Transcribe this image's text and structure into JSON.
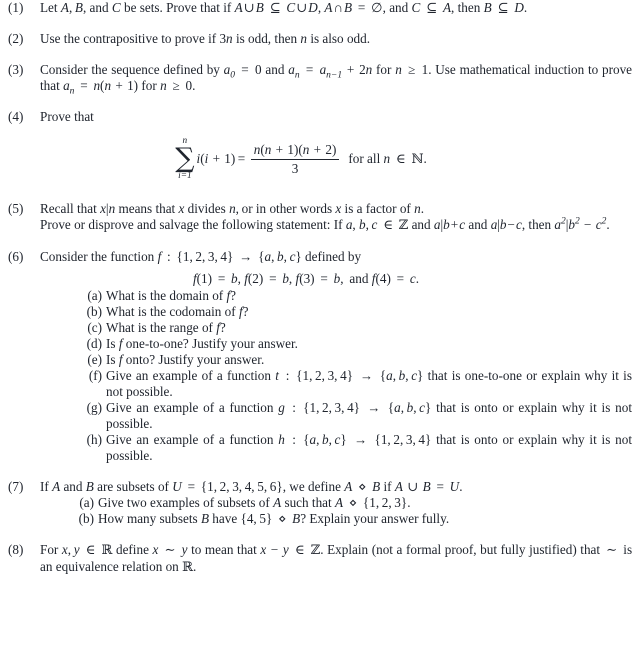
{
  "document": {
    "type": "mathematics-problem-set",
    "text_color": "#20252e",
    "background_color": "#ffffff"
  },
  "problems": [
    {
      "number": "(1)",
      "text": "Let A, B, and C be sets. Prove that if A∪B ⊆ C∪D, A∩B = ∅, and C ⊆ A, then B ⊆ D."
    },
    {
      "number": "(2)",
      "text": "Use the contrapositive to prove if 3n is odd, then n is also odd."
    },
    {
      "number": "(3)",
      "text": "Consider the sequence defined by a₀ = 0 and aₙ = aₙ₋₁ + 2n for n ≥ 1. Use mathematical induction to prove that aₙ = n(n + 1) for n ≥ 0."
    },
    {
      "number": "(4)",
      "text": "Prove that",
      "equation": {
        "sum_upper": "n",
        "sum_lower": "i=1",
        "summand": "i(i + 1)",
        "equals": "=",
        "numerator": "n(n + 1)(n + 2)",
        "denominator": "3",
        "tail": "for all n ∈ ℕ."
      }
    },
    {
      "number": "(5)",
      "line1": "Recall that x|n means that x divides n, or in other words x is a factor of n.",
      "line2": "Prove or disprove and salvage the following statement: If a, b, c ∈ ℤ and a|b+c and a|b−c, then a²|b² − c²."
    },
    {
      "number": "(6)",
      "text": "Consider the function f : {1, 2, 3, 4} → {a, b, c} defined by",
      "definition": "f(1) = b, f(2) = b, f(3) = b, and f(4) = c.",
      "subitems": [
        {
          "label": "(a)",
          "text": "What is the domain of f?"
        },
        {
          "label": "(b)",
          "text": "What is the codomain of f?"
        },
        {
          "label": "(c)",
          "text": "What is the range of f?"
        },
        {
          "label": "(d)",
          "text": "Is f one-to-one? Justify your answer."
        },
        {
          "label": "(e)",
          "text": "Is f onto? Justify your answer."
        },
        {
          "label": "(f)",
          "text": "Give an example of a function t : {1, 2, 3, 4} → {a, b, c} that is one-to-one or explain why it is not possible."
        },
        {
          "label": "(g)",
          "text": "Give an example of a function g : {1, 2, 3, 4} → {a, b, c} that is onto or explain why it is not possible."
        },
        {
          "label": "(h)",
          "text": "Give an example of a function h : {a, b, c} → {1, 2, 3, 4} that is onto or explain why it is not possible."
        }
      ]
    },
    {
      "number": "(7)",
      "text": "If A and B are subsets of U = {1, 2, 3, 4, 5, 6}, we define A ⋄ B if A ∪ B = U.",
      "subitems": [
        {
          "label": "(a)",
          "text": "Give two examples of subsets of A such that A ⋄ {1, 2, 3}."
        },
        {
          "label": "(b)",
          "text": "How many subsets B have {4, 5} ⋄ B? Explain your answer fully."
        }
      ]
    },
    {
      "number": "(8)",
      "text": "For x, y ∈ ℝ define x ∼ y to mean that x − y ∈ ℤ. Explain (not a formal proof, but fully justified) that ∼ is an equivalence relation on ℝ."
    }
  ]
}
